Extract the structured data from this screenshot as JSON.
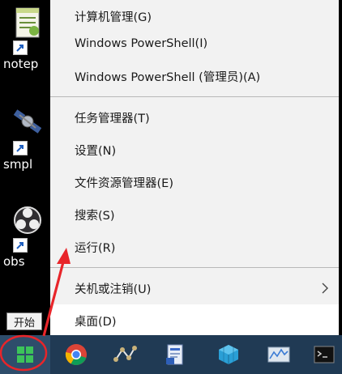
{
  "desktop": {
    "icons": [
      {
        "label": "notep",
        "icon": "notepad-plus-icon"
      },
      {
        "label": "smpl",
        "icon": "satellite-icon"
      },
      {
        "label": "obs",
        "icon": "obs-icon"
      }
    ]
  },
  "menu": {
    "items": [
      {
        "label": "计算机管理(G)"
      },
      {
        "label": "Windows PowerShell(I)"
      },
      {
        "label": "Windows PowerShell (管理员)(A)"
      },
      {
        "label": "任务管理器(T)"
      },
      {
        "label": "设置(N)"
      },
      {
        "label": "文件资源管理器(E)"
      },
      {
        "label": "搜索(S)"
      },
      {
        "label": "运行(R)"
      },
      {
        "label": "关机或注销(U)",
        "submenu_icon": "chevron-right-icon"
      },
      {
        "label": "桌面(D)"
      }
    ]
  },
  "tooltip": {
    "text": "开始"
  },
  "taskbar": {
    "items": [
      "windows-start-icon",
      "chrome-icon",
      "network-app-icon",
      "document-app-icon",
      "cube-app-icon",
      "chart-app-icon",
      "terminal-icon"
    ]
  },
  "annotation": {
    "color": "#e8252a"
  },
  "colors": {
    "taskbar": "#203a54",
    "menu_bg": "#f2f2f2",
    "menu_highlight": "#ffffff"
  }
}
